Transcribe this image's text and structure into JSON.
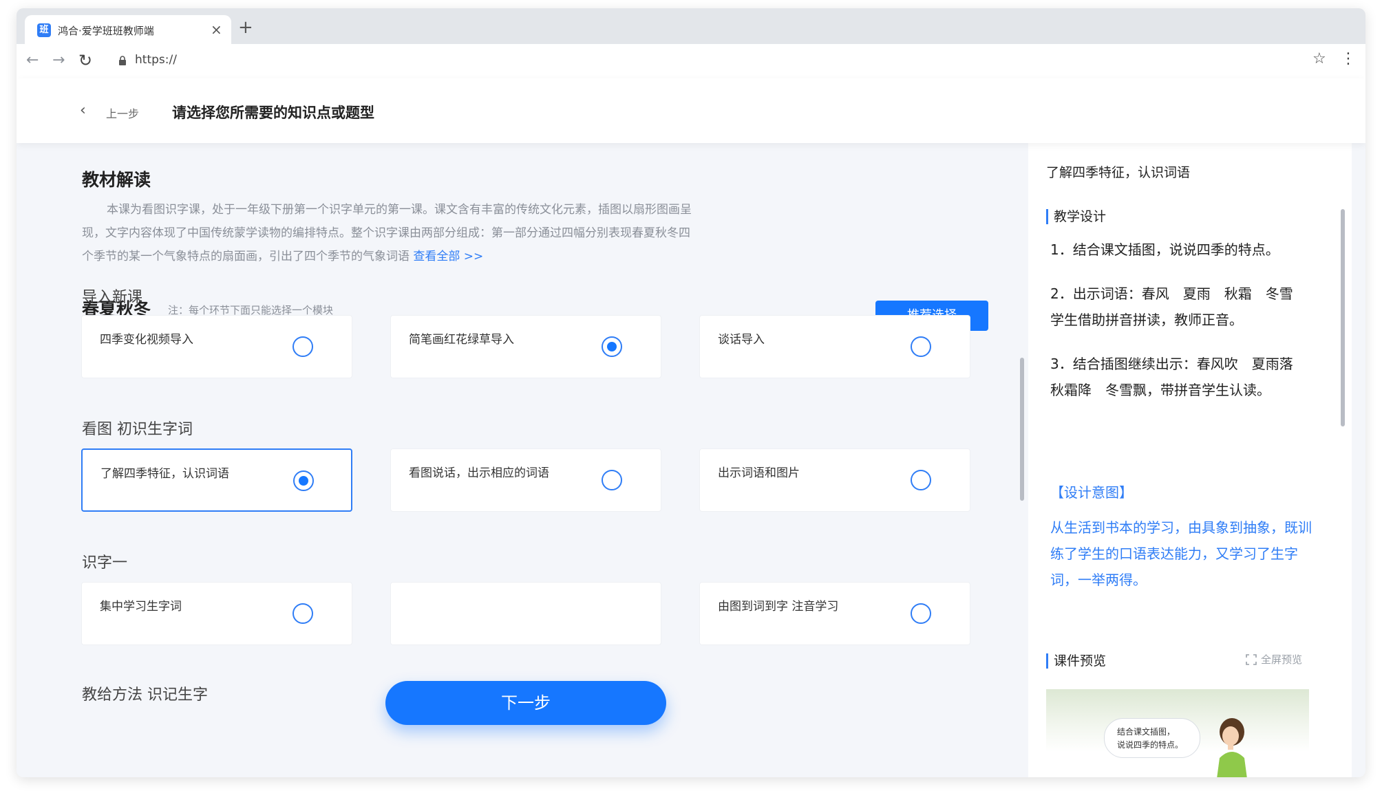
{
  "browser": {
    "tab_title": "鸿合·爱学班班教师端",
    "favicon_text": "班",
    "close_glyph": "×",
    "newtab_glyph": "+",
    "url": "https://"
  },
  "header": {
    "back_label": "上一步",
    "title": "请选择您所需要的知识点或题型"
  },
  "jiaocai": {
    "title": "教材解读",
    "text": "本课为看图识字课，处于一年级下册第一个识字单元的第一课。课文含有丰富的传统文化元素，插图以扇形图画呈现，文字内容体现了中国传统蒙学读物的编排特点。整个识字课由两部分组成：第一部分通过四幅分别表现春夏秋冬四个季节的某一个气象特点的扇面画，引出了四个季节的气象词语",
    "more": "查看全部 >>"
  },
  "lesson": {
    "title": "春夏秋冬",
    "note": "注：每个环节下面只能选择一个模块",
    "recommend_label": "推荐选择"
  },
  "groups": [
    {
      "title": "导入新课",
      "options": [
        {
          "label": "四季变化视频导入",
          "selected": false
        },
        {
          "label": "简笔画红花绿草导入",
          "selected": true
        },
        {
          "label": "谈话导入",
          "selected": false
        }
      ]
    },
    {
      "title": "看图 初识生字词",
      "options": [
        {
          "label": "了解四季特征，认识词语",
          "selected": true
        },
        {
          "label": "看图说话，出示相应的词语",
          "selected": false
        },
        {
          "label": "出示词语和图片",
          "selected": false
        }
      ]
    },
    {
      "title": "识字一",
      "options": [
        {
          "label": "集中学习生字词",
          "selected": false
        },
        {
          "label": "",
          "selected": false
        },
        {
          "label": "由图到词到字 注音学习",
          "selected": false
        }
      ]
    },
    {
      "title": "教给方法 识记生字",
      "options": []
    }
  ],
  "next_label": "下一步",
  "side": {
    "top_title": "了解四季特征，认识词语",
    "design_title": "教学设计",
    "steps": [
      "1．结合课文插图，说说四季的特点。",
      "2．出示词语：春风　夏雨　秋霜　冬雪　学生借助拼音拼读，教师正音。",
      "3．结合插图继续出示：春风吹　夏雨落　秋霜降　冬雪飘，带拼音学生认读。"
    ],
    "intent_title": "【设计意图】",
    "intent_text": "从生活到书本的学习，由具象到抽象，既训练了学生的口语表达能力，又学习了生字词，一举两得。",
    "preview_title": "课件预览",
    "fullscreen_label": "全屏预览",
    "bubble_line1": "结合课文插图，",
    "bubble_line2": "说说四季的特点。"
  },
  "colors": {
    "accent": "#1677ff",
    "accent_text": "#2f7df6",
    "page_bg": "#f4f6fa"
  }
}
